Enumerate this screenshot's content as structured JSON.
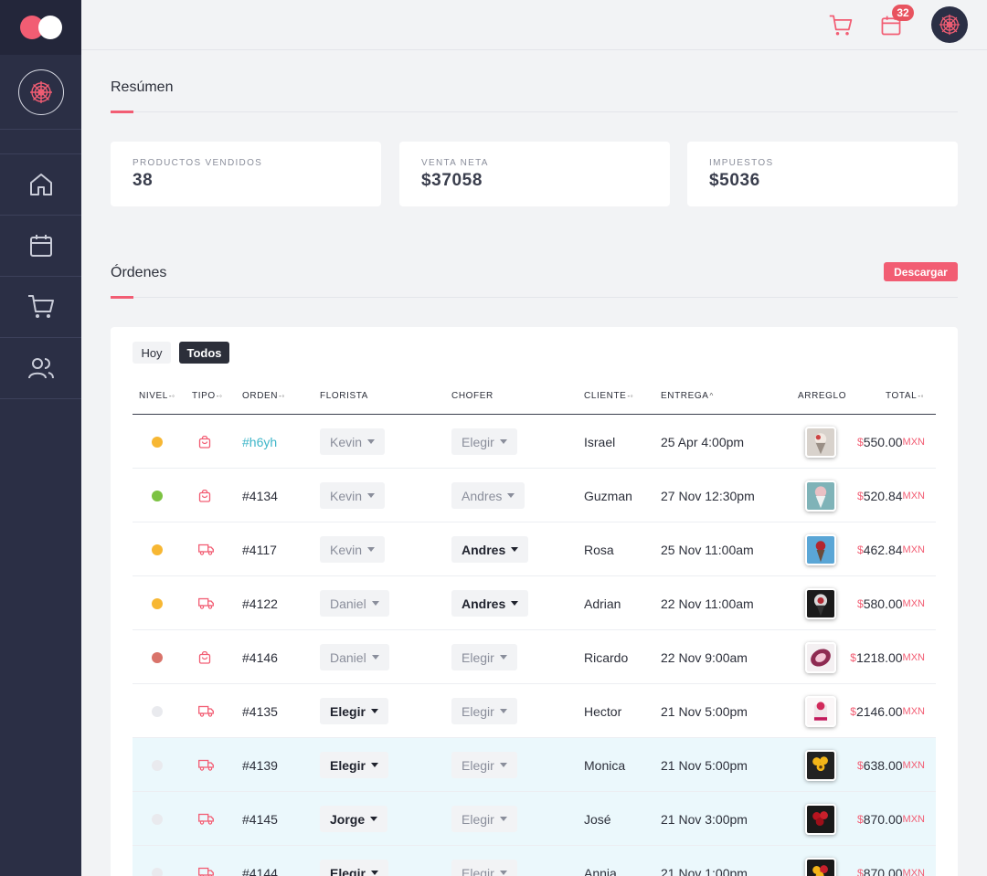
{
  "topbar": {
    "cart_icon": "cart-icon",
    "calendar_icon": "calendar-icon",
    "calendar_badge": "32",
    "avatar_icon": "flower-icon"
  },
  "sidebar": {
    "avatar_icon": "flower-icon",
    "items": [
      {
        "icon": "home-icon"
      },
      {
        "icon": "calendar-icon"
      },
      {
        "icon": "cart-icon"
      },
      {
        "icon": "users-icon"
      }
    ]
  },
  "summary": {
    "title": "Resúmen",
    "cards": [
      {
        "label": "PRODUCTOS VENDIDOS",
        "value": "38"
      },
      {
        "label": "VENTA NETA",
        "value": "$37058"
      },
      {
        "label": "IMPUESTOS",
        "value": "$5036"
      }
    ]
  },
  "orders": {
    "title": "Órdenes",
    "download_label": "Descargar",
    "filters": {
      "today": "Hoy",
      "all": "Todos"
    },
    "columns": {
      "nivel": "NIVEL",
      "tipo": "TIPO",
      "orden": "ORDEN",
      "florista": "FLORISTA",
      "chofer": "CHOFER",
      "cliente": "CLIENTE",
      "entrega": "ENTREGA",
      "arreglo": "ARREGLO",
      "total": "TOTAL"
    },
    "currency_symbol": "$",
    "currency_code": "MXN",
    "colors": {
      "yellow": "#f7b733",
      "green": "#7cc242",
      "red": "#d9736a",
      "grey": "#e9eaee",
      "accent": "#f25d73",
      "link": "#3fb6c9"
    },
    "rows": [
      {
        "level": "yellow",
        "type": "bag-icon",
        "order": "#h6yh",
        "link": true,
        "florist": "Kevin",
        "florist_active": false,
        "driver": "Elegir",
        "driver_active": false,
        "client": "Israel",
        "delivery": "25 Apr 4:00pm",
        "total": "550.00",
        "highlight": false,
        "arrangement": "bouquet-white"
      },
      {
        "level": "green",
        "type": "bag-icon",
        "order": "#4134",
        "link": false,
        "florist": "Kevin",
        "florist_active": false,
        "driver": "Andres",
        "driver_active": false,
        "client": "Guzman",
        "delivery": "27 Nov 12:30pm",
        "total": "520.84",
        "highlight": false,
        "arrangement": "bouquet-teal"
      },
      {
        "level": "yellow",
        "type": "truck-icon",
        "order": "#4117",
        "link": false,
        "florist": "Kevin",
        "florist_active": false,
        "driver": "Andres",
        "driver_active": true,
        "client": "Rosa",
        "delivery": "25 Nov 11:00am",
        "total": "462.84",
        "highlight": false,
        "arrangement": "bouquet-blue"
      },
      {
        "level": "yellow",
        "type": "truck-icon",
        "order": "#4122",
        "link": false,
        "florist": "Daniel",
        "florist_active": false,
        "driver": "Andres",
        "driver_active": true,
        "client": "Adrian",
        "delivery": "22 Nov 11:00am",
        "total": "580.00",
        "highlight": false,
        "arrangement": "bouquet-dark"
      },
      {
        "level": "red",
        "type": "bag-icon",
        "order": "#4146",
        "link": false,
        "florist": "Daniel",
        "florist_active": false,
        "driver": "Elegir",
        "driver_active": false,
        "client": "Ricardo",
        "delivery": "22 Nov 9:00am",
        "total": "1218.00",
        "highlight": false,
        "arrangement": "bouquet-pink"
      },
      {
        "level": "grey",
        "type": "truck-icon",
        "order": "#4135",
        "link": false,
        "florist": "Elegir",
        "florist_active": true,
        "driver": "Elegir",
        "driver_active": false,
        "client": "Hector",
        "delivery": "21 Nov 5:00pm",
        "total": "2146.00",
        "highlight": false,
        "arrangement": "box-pink"
      },
      {
        "level": "grey",
        "type": "truck-icon",
        "order": "#4139",
        "link": false,
        "florist": "Elegir",
        "florist_active": true,
        "driver": "Elegir",
        "driver_active": false,
        "client": "Monica",
        "delivery": "21 Nov 5:00pm",
        "total": "638.00",
        "highlight": true,
        "arrangement": "sunflowers"
      },
      {
        "level": "grey",
        "type": "truck-icon",
        "order": "#4145",
        "link": false,
        "florist": "Jorge",
        "florist_active": true,
        "driver": "Elegir",
        "driver_active": false,
        "client": "José",
        "delivery": "21 Nov 3:00pm",
        "total": "870.00",
        "highlight": true,
        "arrangement": "roses-red"
      },
      {
        "level": "grey",
        "type": "truck-icon",
        "order": "#4144",
        "link": false,
        "florist": "Elegir",
        "florist_active": true,
        "driver": "Elegir",
        "driver_active": false,
        "client": "Annia",
        "delivery": "21 Nov 1:00pm",
        "total": "870.00",
        "highlight": true,
        "arrangement": "sunflowers-red"
      }
    ]
  }
}
